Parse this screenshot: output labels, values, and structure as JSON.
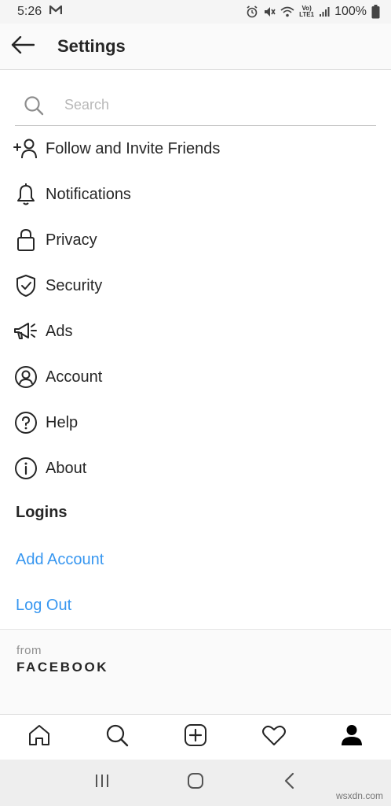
{
  "status_bar": {
    "time": "5:26",
    "app_icon": "gmail-m-icon",
    "battery": "100%",
    "volte_top": "Vo)",
    "volte_bottom": "LTE1"
  },
  "header": {
    "title": "Settings",
    "back_icon": "back-arrow-icon"
  },
  "search": {
    "placeholder": "Search",
    "icon": "search-icon"
  },
  "menu": {
    "items": [
      {
        "label": "Follow and Invite Friends",
        "icon": "add-person-icon"
      },
      {
        "label": "Notifications",
        "icon": "bell-icon"
      },
      {
        "label": "Privacy",
        "icon": "lock-icon"
      },
      {
        "label": "Security",
        "icon": "shield-check-icon"
      },
      {
        "label": "Ads",
        "icon": "megaphone-icon"
      },
      {
        "label": "Account",
        "icon": "account-circle-icon"
      },
      {
        "label": "Help",
        "icon": "help-circle-icon"
      },
      {
        "label": "About",
        "icon": "info-circle-icon"
      }
    ]
  },
  "logins": {
    "title": "Logins",
    "add_account": "Add Account",
    "log_out": "Log Out"
  },
  "footer": {
    "from": "from",
    "brand": "FACEBOOK"
  },
  "bottom_nav": {
    "items": [
      "home-icon",
      "search-icon",
      "add-post-icon",
      "heart-icon",
      "profile-icon"
    ]
  },
  "watermark": "wsxdn.com",
  "colors": {
    "link": "#3897f0",
    "text": "#262626",
    "muted": "#8e8e8e"
  }
}
